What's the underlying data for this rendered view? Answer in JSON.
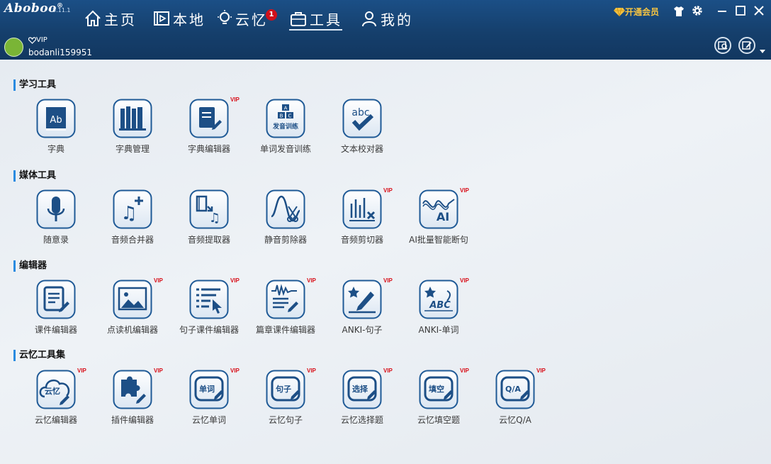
{
  "app": {
    "logo": "Aboboo",
    "registered_mark": "®",
    "version": "3.11.1"
  },
  "nav": [
    {
      "label": "主页",
      "icon": "home-icon"
    },
    {
      "label": "本地",
      "icon": "local-media-icon"
    },
    {
      "label": "云忆",
      "icon": "lightbulb-icon",
      "badge": "1"
    },
    {
      "label": "工具",
      "icon": "toolbox-icon",
      "active": true
    },
    {
      "label": "我的",
      "icon": "user-icon"
    }
  ],
  "header": {
    "vip_button": "开通会员"
  },
  "user": {
    "vip_tag": "VIP",
    "username": "bodanli159951"
  },
  "colors": {
    "header_bg": "#153f6c",
    "icon_fill": "#1d4f86",
    "vip_red": "#d80d17",
    "accent": "#2a8be0",
    "vip_gold": "#f5c342"
  },
  "sections": [
    {
      "title": "学习工具",
      "tools": [
        {
          "label": "字典",
          "icon": "dictionary-icon",
          "vip": false
        },
        {
          "label": "字典管理",
          "icon": "dictionary-manage-icon",
          "vip": false
        },
        {
          "label": "字典编辑器",
          "icon": "dictionary-editor-icon",
          "vip": true
        },
        {
          "label": "单词发音训练",
          "icon": "pronunciation-training-icon",
          "vip": false,
          "glyph": "发音训练"
        },
        {
          "label": "文本校对器",
          "icon": "text-proofreader-icon",
          "vip": false,
          "glyph": "abc"
        }
      ]
    },
    {
      "title": "媒体工具",
      "tools": [
        {
          "label": "随意录",
          "icon": "microphone-icon",
          "vip": false
        },
        {
          "label": "音频合并器",
          "icon": "audio-merge-icon",
          "vip": false
        },
        {
          "label": "音频提取器",
          "icon": "audio-extract-icon",
          "vip": false
        },
        {
          "label": "静音剪除器",
          "icon": "silence-cut-icon",
          "vip": false
        },
        {
          "label": "音频剪切器",
          "icon": "audio-cut-icon",
          "vip": true
        },
        {
          "label": "AI批量智能断句",
          "icon": "ai-segment-icon",
          "vip": true,
          "glyph": "AI"
        }
      ]
    },
    {
      "title": "编辑器",
      "tools": [
        {
          "label": "课件编辑器",
          "icon": "courseware-editor-icon",
          "vip": false
        },
        {
          "label": "点读机编辑器",
          "icon": "reader-editor-icon",
          "vip": true
        },
        {
          "label": "句子课件编辑器",
          "icon": "sentence-editor-icon",
          "vip": true
        },
        {
          "label": "篇章课件编辑器",
          "icon": "passage-editor-icon",
          "vip": true
        },
        {
          "label": "ANKI-句子",
          "icon": "anki-sentence-icon",
          "vip": true
        },
        {
          "label": "ANKI-单词",
          "icon": "anki-word-icon",
          "vip": true,
          "glyph": "ABC"
        }
      ]
    },
    {
      "title": "云忆工具集",
      "tools": [
        {
          "label": "云忆编辑器",
          "icon": "cloud-editor-icon",
          "vip": true,
          "glyph": "云忆"
        },
        {
          "label": "插件编辑器",
          "icon": "plugin-editor-icon",
          "vip": true
        },
        {
          "label": "云忆单词",
          "icon": "cloud-word-icon",
          "vip": true,
          "glyph": "单词"
        },
        {
          "label": "云忆句子",
          "icon": "cloud-sentence-icon",
          "vip": true,
          "glyph": "句子"
        },
        {
          "label": "云忆选择题",
          "icon": "cloud-choice-icon",
          "vip": true,
          "glyph": "选择"
        },
        {
          "label": "云忆填空题",
          "icon": "cloud-fill-icon",
          "vip": true,
          "glyph": "填空"
        },
        {
          "label": "云忆Q/A",
          "icon": "cloud-qa-icon",
          "vip": true,
          "glyph": "Q/A"
        }
      ]
    }
  ]
}
